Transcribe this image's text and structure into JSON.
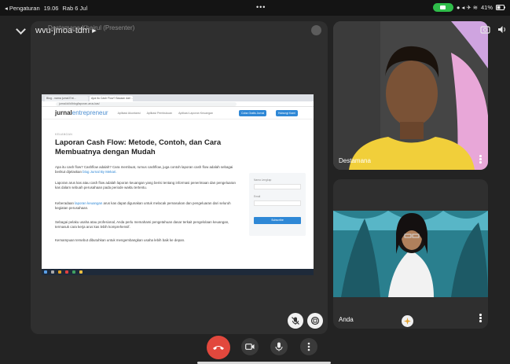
{
  "status_bar": {
    "back_label": "◂ Pengaturan",
    "time": "19.06",
    "date": "Rab 6 Jul",
    "battery": "41%"
  },
  "meeting": {
    "code": "wvu-jmoa-tdm",
    "presenter": "Destamana Khairul (Presenter)"
  },
  "shared_screen": {
    "tabs": [
      "Blog - nama jurnal Ent...",
      "Apa itu Cash Flow? Bacaan dari ..."
    ],
    "url": "jurnal.id/id/blog/laporan-arus-kas/",
    "logo_main": "jurnal",
    "logo_sub": "entrepreneur",
    "nav": [
      "Aplikasi Akuntansi",
      "Aplikasi Pembukuan",
      "Aplikasi Laporan Keuangan"
    ],
    "btn_trial": "Coba Gratis Jurnal",
    "btn_contact": "Hubungi Kami",
    "category": "KEUANGAN",
    "title": "Laporan Cash Flow: Metode, Contoh, dan Cara Membuatnya dengan Mudah",
    "p1_a": "Apa itu cash flow? Cashflow adalah? Cara membuat, rumus cashflow, juga contoh laporan cash flow adalah sebagai berikut dijelaskan ",
    "p1_link": "blog Jurnal By Mekari.",
    "p2": "Laporan arus kas atau cash flow adalah laporan keuangan yang berisi tentang informasi penerimaan dan pengeluaran kas dalam sebuah perusahaan pada periode waktu tertentu.",
    "p3_a": "Keberadaan ",
    "p3_link": "laporan keuangan",
    "p3_b": " arus kas dapat digunakan untuk melacak pemasukan dan pengeluaran dari seluruh kegiatan perusahaan.",
    "p4": "Sebagai pelaku usaha atau profesional, Anda perlu memahami pengetahuan dasar terkait pengelolaan keuangan, termasuk cara kerja arus kas lebih komprehensif.",
    "p5": "Kemampuan tersebut dibutuhkan untuk mengembangkan usaha lebih baik ke depan.",
    "sidebar_name_label": "Nama Lengkap",
    "sidebar_email_label": "Email",
    "sidebar_button": "Subscribe"
  },
  "participants": [
    {
      "name": "Destamana"
    },
    {
      "name": "Anda"
    }
  ],
  "colors": {
    "end_call": "#e2483d",
    "accent_blue": "#2f88d6"
  }
}
